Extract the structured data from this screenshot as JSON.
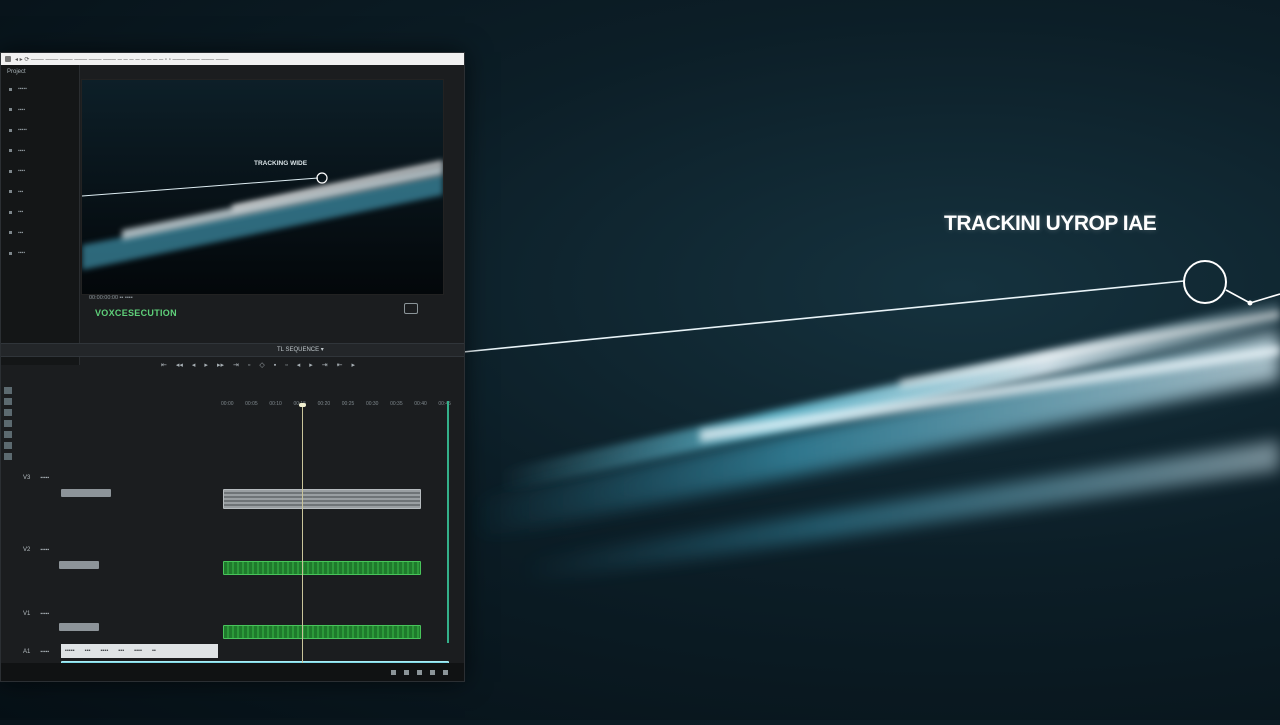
{
  "hero": {
    "title": "TRACKINI UYROP IAE"
  },
  "window": {
    "title_text": "◂ ▸ ⟳  ─── ─── ─── ─── ─── ─── ─ ─ ─ ─ ─ ─ ─ ─   ▫ ▫   ─── ─── ─── ───"
  },
  "project_panel": {
    "title": "Project",
    "items": [
      "▪▪▪▪▪",
      "▪▪▪▪",
      "▪▪▪▪▪",
      "▪▪▪▪",
      "▪▪▪▪",
      "▪▪▪",
      "▪▪▪",
      "▪▪▪",
      "▪▪▪▪"
    ]
  },
  "viewer": {
    "overlay_label": "TRACKING WIDE",
    "timecode": "00:00:00:00  ▪▪ ▪▪▪▪",
    "source_name": "VOXCESECUTION"
  },
  "mid_bar": {
    "label": "TL SEQUENCE  ▾"
  },
  "transport": {
    "buttons": [
      "⇤",
      "◂◂",
      "◂",
      "▸",
      "▸▸",
      "⇥",
      "▫",
      "◇",
      "▪",
      "▫",
      "◂",
      "▸",
      "⇥",
      "⇤",
      "▸"
    ]
  },
  "timeline": {
    "ruler_ticks": [
      "00:00",
      "00:05",
      "00:10",
      "00:15",
      "00:20",
      "00:25",
      "00:30",
      "00:35",
      "00:40",
      "00:45"
    ],
    "tracks": [
      {
        "num": "V3",
        "name": "▪▪▪▪▪"
      },
      {
        "num": "V2",
        "name": "▪▪▪▪▪"
      },
      {
        "num": "V1",
        "name": "▪▪▪▪▪"
      },
      {
        "num": "A1",
        "name": "▪▪▪▪▪"
      }
    ],
    "clip_label": "▪▪▪▪▪",
    "bottom_strip": [
      "▪▪▪▪▪",
      "▪▪▪",
      "▪▪▪▪",
      "▪▪▪",
      "▪▪▪▪",
      "▪▪"
    ]
  },
  "colors": {
    "accent_green": "#2c9a3a",
    "accent_cyan": "#6ccfe0",
    "background": "#0c1e27"
  }
}
